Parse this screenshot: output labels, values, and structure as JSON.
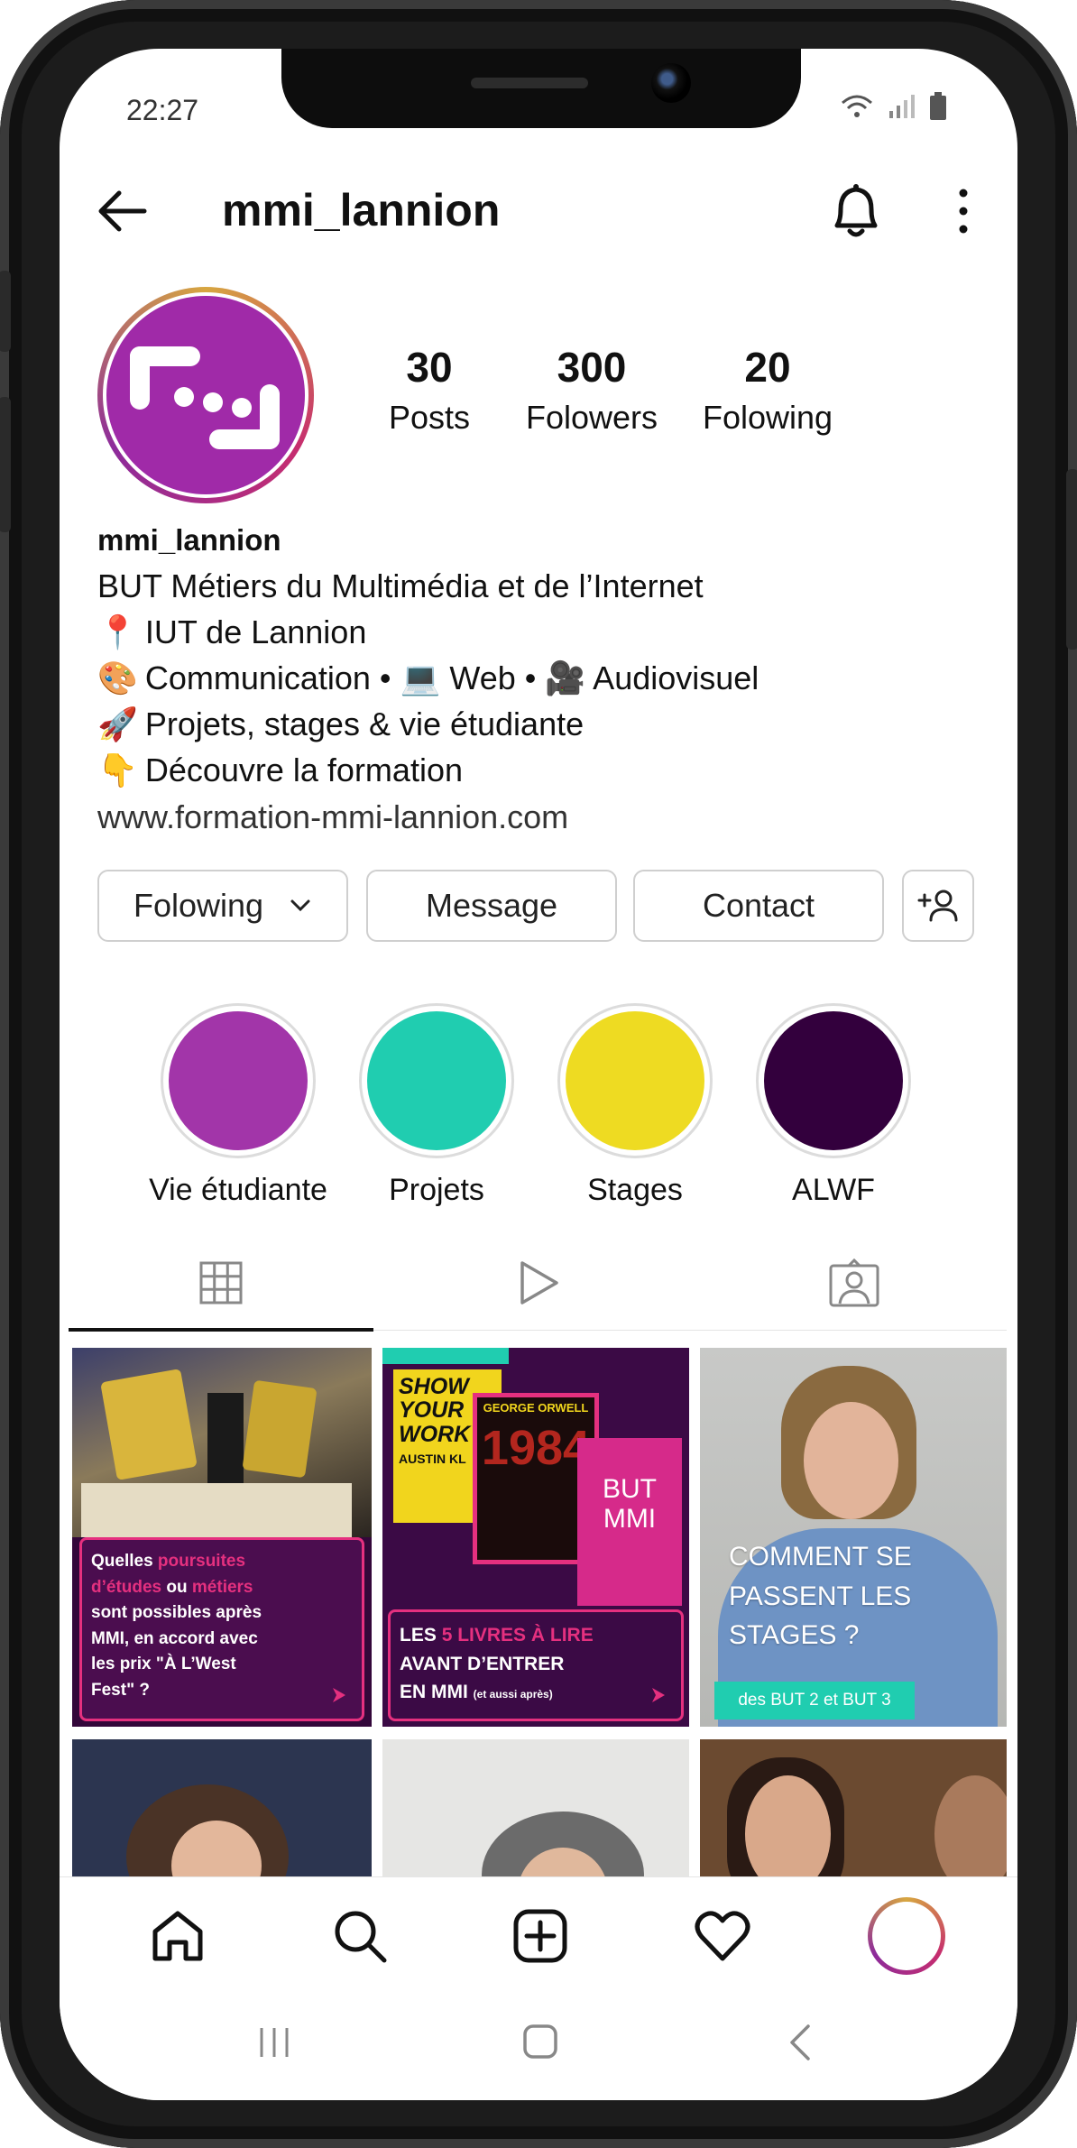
{
  "status": {
    "time": "22:27"
  },
  "profile": {
    "username": "mmi_lannion",
    "posts_count": "30",
    "posts_label": "Posts",
    "followers_count": "300",
    "followers_label": "Folowers",
    "following_count": "20",
    "following_label": "Folowing",
    "bio_name": "mmi_lannion",
    "bio_lines": [
      {
        "emoji": "",
        "text": "BUT Métiers du Multimédia et de l’Internet"
      },
      {
        "emoji": "📍",
        "text": "IUT de Lannion"
      },
      {
        "emoji": "🎨",
        "text": "Communication • 💻 Web • 🎥 Audiovisuel"
      },
      {
        "emoji": "🚀",
        "text": "Projets, stages & vie étudiante"
      },
      {
        "emoji": "👇",
        "text": "Découvre la formation"
      }
    ],
    "website": "www.formation-mmi-lannion.com"
  },
  "actions": {
    "following_label": "Folowing",
    "message_label": "Message",
    "contact_label": "Contact"
  },
  "highlights": [
    {
      "label": "Vie étudiante",
      "color": "#a235a9"
    },
    {
      "label": "Projets",
      "color": "#20cdb0"
    },
    {
      "label": "Stages",
      "color": "#eedb22"
    },
    {
      "label": "ALWF",
      "color": "#33003d"
    }
  ],
  "tabs": [
    "grid-icon",
    "reels-icon",
    "tagged-icon"
  ],
  "posts": {
    "post1": {
      "text_line1a": "Quelles ",
      "text_line1b": "poursuites",
      "text_line2a": "d’études",
      "text_line2b": " ou ",
      "text_line2c": "métiers",
      "text_line3": "sont possibles après",
      "text_line4": "MMI, en accord avec",
      "text_line5": "les prix  \"À L’West",
      "text_line6": "Fest\"  ?"
    },
    "post2": {
      "book1": "SHOW YOUR WORK",
      "book1_author": "AUSTIN KL",
      "book2_author": "GEORGE ORWELL",
      "book2_title": "1984",
      "book3": "BUT MMI",
      "text_line1a": "LES ",
      "text_line1b": "5 LIVRES À LIRE",
      "text_line2": "AVANT D’ENTRER",
      "text_line3": "EN MMI",
      "text_small": "(et aussi après)"
    },
    "post3": {
      "text": "COMMENT SE PASSENT LES STAGES ?",
      "badge": "des BUT 2 et BUT 3"
    }
  },
  "colors": {
    "brand_purple": "#a02aa8",
    "pink": "#e5307f",
    "dark_purple": "#4b0d4f",
    "teal": "#20cdb0"
  }
}
